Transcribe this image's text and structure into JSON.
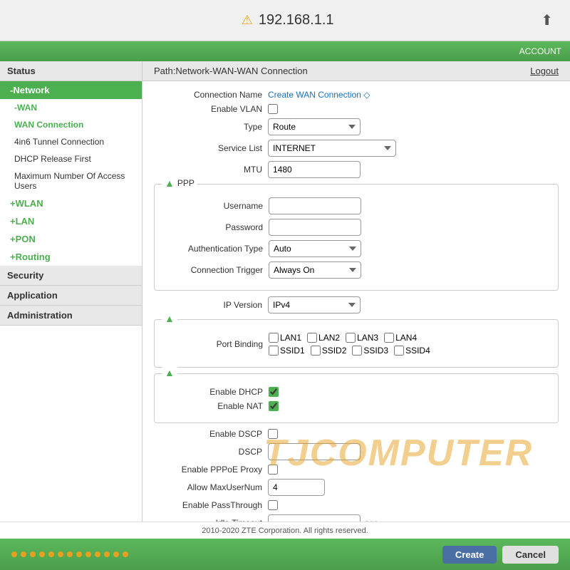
{
  "topbar": {
    "warning_icon": "⚠",
    "title": "192.168.1.1",
    "share_icon": "⬆"
  },
  "green_header": {
    "account_label": "ACCOUNT"
  },
  "sidebar": {
    "status_label": "Status",
    "network_label": "-Network",
    "wan_label": "-WAN",
    "wan_connection_label": "WAN Connection",
    "tunnel_label": "4in6 Tunnel Connection",
    "dhcp_label": "DHCP Release First",
    "max_users_label": "Maximum Number Of Access Users",
    "wlan_label": "+WLAN",
    "lan_label": "+LAN",
    "pon_label": "+PON",
    "routing_label": "+Routing",
    "security_label": "Security",
    "application_label": "Application",
    "administration_label": "Administration"
  },
  "path": {
    "text": "Path:Network-WAN-WAN Connection",
    "logout": "Logout"
  },
  "form": {
    "connection_name_label": "Connection Name",
    "connection_name_value": "Create WAN Connection ◇",
    "enable_vlan_label": "Enable VLAN",
    "type_label": "Type",
    "type_value": "Route",
    "service_list_label": "Service List",
    "service_list_value": "INTERNET",
    "mtu_label": "MTU",
    "mtu_value": "1480",
    "ppp_label": "PPP",
    "username_label": "Username",
    "password_label": "Password",
    "auth_type_label": "Authentication Type",
    "auth_type_value": "Auto",
    "conn_trigger_label": "Connection Trigger",
    "conn_trigger_value": "Always On",
    "ip_version_label": "IP Version",
    "ip_version_value": "IPv4",
    "port_binding_label": "Port Binding",
    "lan1": "LAN1",
    "lan2": "LAN2",
    "lan3": "LAN3",
    "lan4": "LAN4",
    "ssid1": "SSID1",
    "ssid2": "SSID2",
    "ssid3": "SSID3",
    "ssid4": "SSID4",
    "enable_dhcp_label": "Enable DHCP",
    "enable_nat_label": "Enable NAT",
    "enable_dscp_label": "Enable DSCP",
    "dscp_label": "DSCP",
    "enable_pppoe_label": "Enable PPPoE Proxy",
    "allow_max_label": "Allow MaxUserNum",
    "allow_max_value": "4",
    "enable_passthrough_label": "Enable PassThrough",
    "idle_timeout_label": "Idle Timeout",
    "idle_timeout_value": "sec"
  },
  "buttons": {
    "create": "Create",
    "cancel": "Cancel"
  },
  "copyright": {
    "text": "2010-2020 ZTE Corporation. All rights reserved."
  },
  "watermark": {
    "text": "TJCOMPUTER"
  }
}
